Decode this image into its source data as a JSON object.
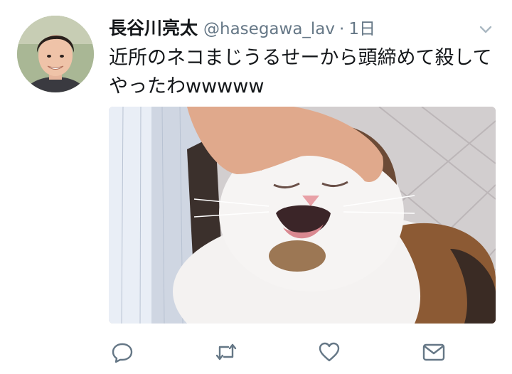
{
  "tweet": {
    "display_name": "長谷川亮太",
    "handle": "@hasegawa_lav",
    "separator": "·",
    "time": "1日",
    "text": "近所のネコまじうるせーから頭締めて殺してやったわwwwww"
  },
  "icons": {
    "avatar": "user-avatar",
    "caret": "chevron-down-icon",
    "reply": "reply-icon",
    "retweet": "retweet-icon",
    "like": "heart-icon",
    "dm": "envelope-icon"
  },
  "colors": {
    "text": "#14171a",
    "secondary": "#657786",
    "icon": "#657786"
  }
}
